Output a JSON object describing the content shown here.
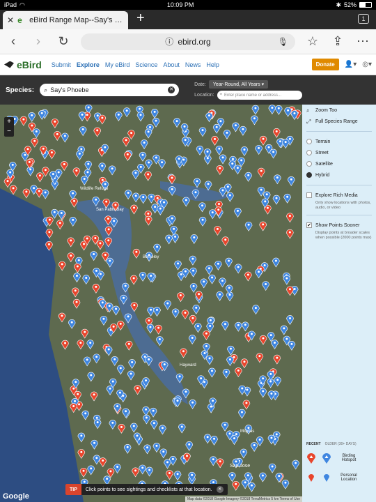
{
  "status": {
    "device": "iPad",
    "time": "10:09 PM",
    "battery": "52%"
  },
  "tab": {
    "title": "eBird Range Map--Say's Phoe",
    "count": "1"
  },
  "url": {
    "host": "ebird.org"
  },
  "header": {
    "logo": "eBird",
    "nav": [
      "Submit",
      "Explore",
      "My eBird",
      "Science",
      "About",
      "News",
      "Help"
    ],
    "donate": "Donate"
  },
  "search": {
    "species_label": "Species:",
    "species_value": "Say's Phoebe",
    "date_label": "Date:",
    "date_value": "Year-Round, All Years",
    "location_label": "Location:",
    "location_placeholder": "Enter place name or address..."
  },
  "panel": {
    "zoom_label": "Zoom Too",
    "full_range": "Full Species Range",
    "map_types": [
      "Terrain",
      "Street",
      "Satellite",
      "Hybrid"
    ],
    "selected_map_type": "Hybrid",
    "rich_media_title": "Explore Rich Media",
    "rich_media_desc": "Only show locations with photos, audio, or video",
    "points_title": "Show Points Sooner",
    "points_desc": "Display points at broader scales when possible (2000 points max)",
    "legend": {
      "recent": "RECENT",
      "older": "OLDER (30+ DAYS)",
      "hotspot": "Birding Hotspot",
      "personal": "Personal Location"
    }
  },
  "map": {
    "labels": [
      "San Pablo Bay",
      "Wildlife Refuge",
      "San Jose",
      "Milpitas",
      "Hayward",
      "Berkeley"
    ],
    "google": "Google",
    "attribution": "Map data ©2018 Google Imagery ©2018 TerraMetrics   5 km   Terms of Use",
    "tip_badge": "TIP",
    "tip_text": "Click points to see sightings and checklists at that location.",
    "colors": {
      "recent": "#e8452c",
      "older": "#3f86e0",
      "water": "#4d6c92",
      "land": "#5e6a4f",
      "ocean": "#2d4d82"
    }
  }
}
